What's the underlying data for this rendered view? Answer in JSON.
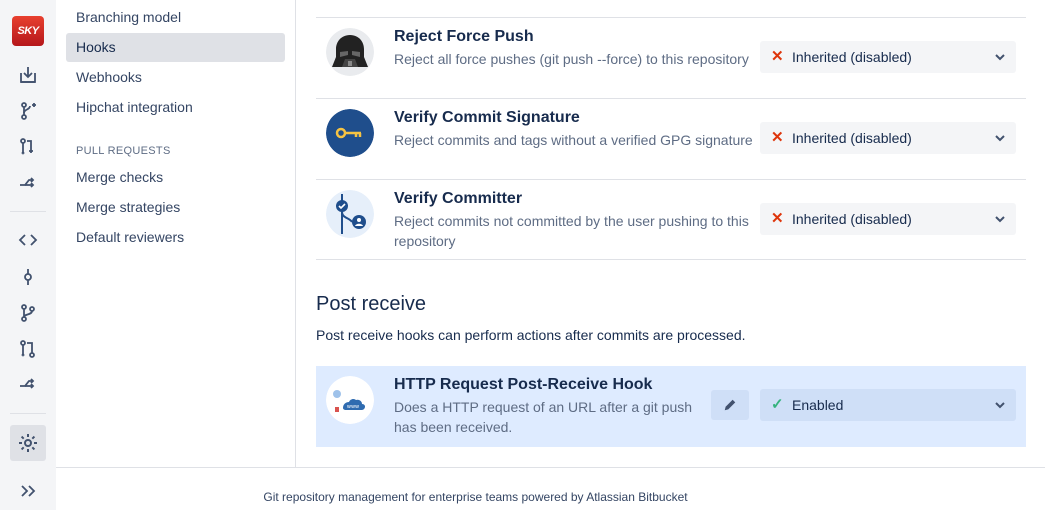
{
  "rail": {
    "logo_text": "SKY",
    "icons": [
      "clone-icon",
      "create-branch-icon",
      "create-pull-request-icon",
      "fork-icon",
      "source-icon",
      "commits-icon",
      "branches-icon",
      "pull-requests-icon",
      "forks-icon",
      "settings-icon",
      "expand-icon"
    ]
  },
  "nav": {
    "items": [
      {
        "label": "Branching model"
      },
      {
        "label": "Hooks"
      },
      {
        "label": "Webhooks"
      },
      {
        "label": "Hipchat integration"
      }
    ],
    "pull_requests_heading": "PULL REQUESTS",
    "pr_items": [
      {
        "label": "Merge checks"
      },
      {
        "label": "Merge strategies"
      },
      {
        "label": "Default reviewers"
      }
    ]
  },
  "hooks": [
    {
      "title": "Reject Force Push",
      "description": "Reject all force pushes (git push --force) to this repository",
      "status": "Inherited (disabled)",
      "icon": "vader-icon"
    },
    {
      "title": "Verify Commit Signature",
      "description": "Reject commits and tags without a verified GPG signature",
      "status": "Inherited (disabled)",
      "icon": "key-icon"
    },
    {
      "title": "Verify Committer",
      "description": "Reject commits not committed by the user pushing to this repository",
      "status": "Inherited (disabled)",
      "icon": "committer-icon"
    }
  ],
  "post_receive": {
    "title": "Post receive",
    "description": "Post receive hooks can perform actions after commits are processed.",
    "hooks": [
      {
        "title": "HTTP Request Post-Receive Hook",
        "description": "Does a HTTP request of an URL after a git push has been received.",
        "status": "Enabled",
        "icon": "http-cloud-icon"
      }
    ]
  },
  "colors": {
    "disabled_mark": "#de350b",
    "enabled_mark": "#36b37e",
    "highlight": "#deebff"
  },
  "footer": {
    "text": "Git repository management for enterprise teams powered by Atlassian Bitbucket"
  }
}
